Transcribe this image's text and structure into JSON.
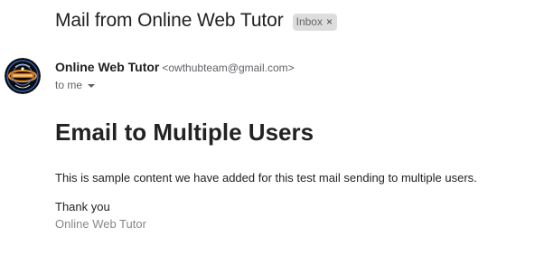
{
  "email": {
    "subject": "Mail from Online Web Tutor",
    "label_chip": "Inbox",
    "label_close_glyph": "×",
    "sender_name": "Online Web Tutor",
    "sender_email": "<owthubteam@gmail.com>",
    "recipient_text": "to me",
    "recipient_caret_icon": "caret-down-icon",
    "avatar_icon": "sender-avatar-logo"
  },
  "body": {
    "heading": "Email to Multiple Users",
    "content": "This is sample content we have added for this test mail sending to multiple users.",
    "closing": "Thank you",
    "signature": "Online Web Tutor"
  },
  "colors": {
    "chip_bg": "#dddddd",
    "text_primary": "#202124",
    "text_secondary": "#5f6368",
    "signature_gray": "#888888"
  }
}
